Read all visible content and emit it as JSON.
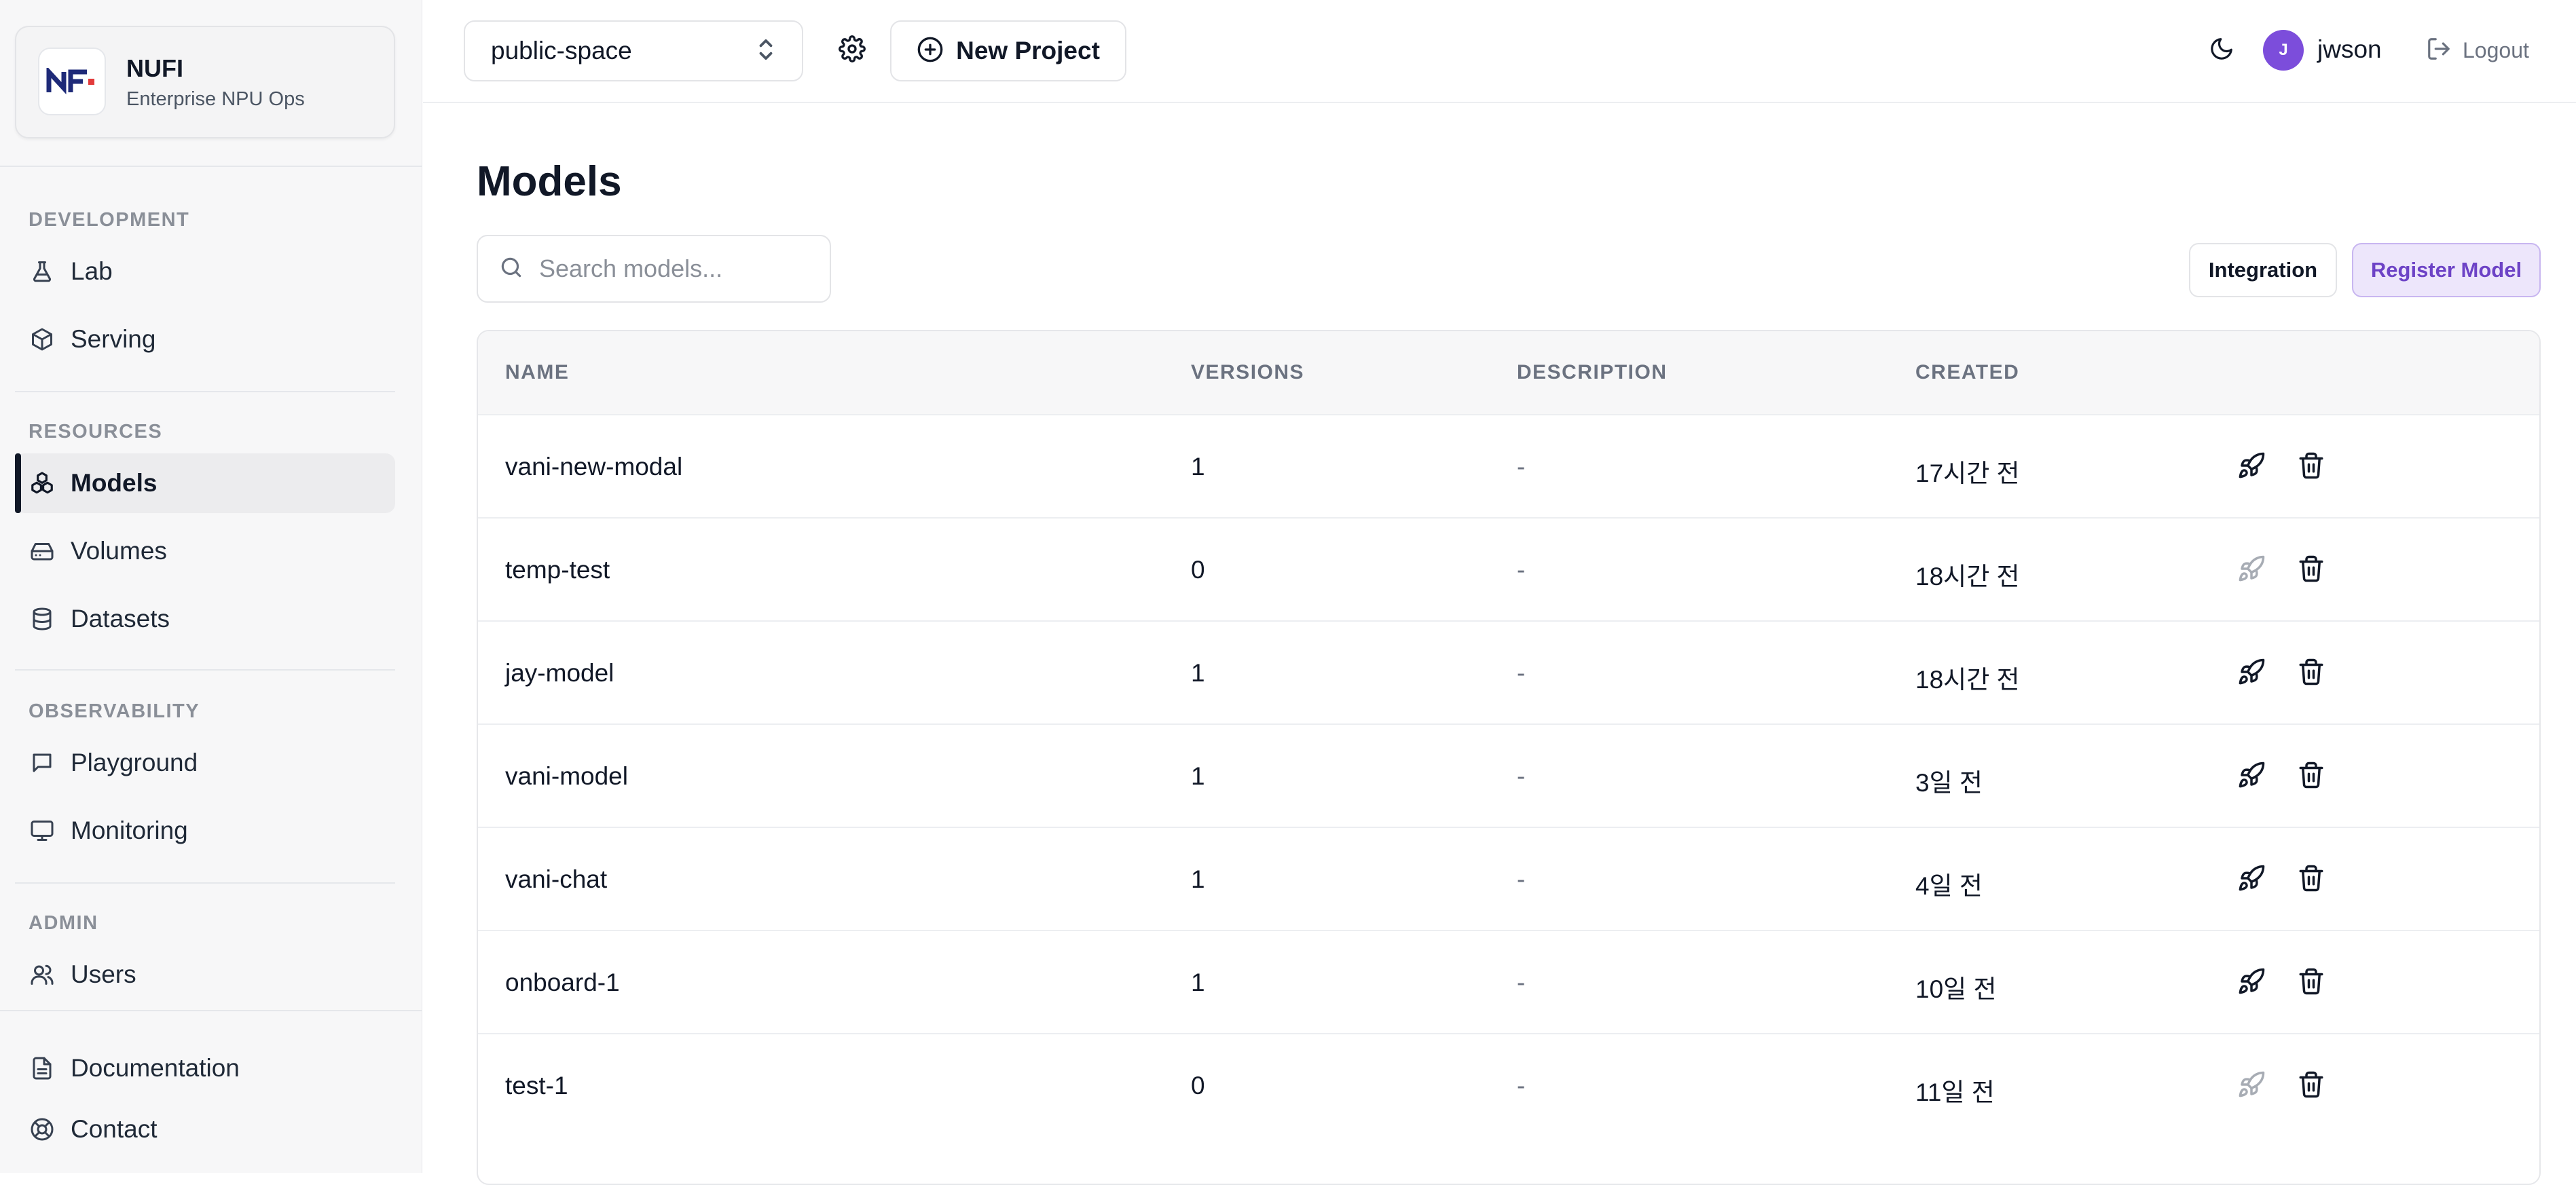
{
  "brand": {
    "name": "NUFI",
    "subtitle": "Enterprise NPU Ops"
  },
  "sidebar": {
    "sections": [
      {
        "label": "DEVELOPMENT",
        "items": [
          {
            "label": "Lab",
            "icon": "flask-icon"
          },
          {
            "label": "Serving",
            "icon": "cube-icon"
          }
        ]
      },
      {
        "label": "RESOURCES",
        "items": [
          {
            "label": "Models",
            "icon": "models-icon",
            "active": true
          },
          {
            "label": "Volumes",
            "icon": "hard-drive-icon"
          },
          {
            "label": "Datasets",
            "icon": "database-icon"
          }
        ]
      },
      {
        "label": "OBSERVABILITY",
        "items": [
          {
            "label": "Playground",
            "icon": "chat-icon"
          },
          {
            "label": "Monitoring",
            "icon": "monitor-icon"
          }
        ]
      },
      {
        "label": "ADMIN",
        "items": [
          {
            "label": "Users",
            "icon": "users-icon"
          }
        ]
      }
    ],
    "footer": [
      {
        "label": "Documentation",
        "icon": "document-icon"
      },
      {
        "label": "Contact",
        "icon": "lifebuoy-icon"
      }
    ]
  },
  "topbar": {
    "project": "public-space",
    "new_project_label": "New Project",
    "user_initial": "J",
    "username": "jwson",
    "logout_label": "Logout"
  },
  "page": {
    "title": "Models",
    "search_placeholder": "Search models...",
    "integration_label": "Integration",
    "register_label": "Register Model"
  },
  "table": {
    "columns": [
      "NAME",
      "VERSIONS",
      "DESCRIPTION",
      "CREATED"
    ],
    "rows": [
      {
        "name": "vani-new-modal",
        "versions": "1",
        "description": "-",
        "created": "17시간 전",
        "deploy_enabled": true
      },
      {
        "name": "temp-test",
        "versions": "0",
        "description": "-",
        "created": "18시간 전",
        "deploy_enabled": false
      },
      {
        "name": "jay-model",
        "versions": "1",
        "description": "-",
        "created": "18시간 전",
        "deploy_enabled": true
      },
      {
        "name": "vani-model",
        "versions": "1",
        "description": "-",
        "created": "3일 전",
        "deploy_enabled": true
      },
      {
        "name": "vani-chat",
        "versions": "1",
        "description": "-",
        "created": "4일 전",
        "deploy_enabled": true
      },
      {
        "name": "onboard-1",
        "versions": "1",
        "description": "-",
        "created": "10일 전",
        "deploy_enabled": true
      },
      {
        "name": "test-1",
        "versions": "0",
        "description": "-",
        "created": "11일 전",
        "deploy_enabled": false
      }
    ]
  },
  "colors": {
    "accent": "#7c4ddb",
    "register_bg": "#ede6fb",
    "register_text": "#6d43c6"
  }
}
